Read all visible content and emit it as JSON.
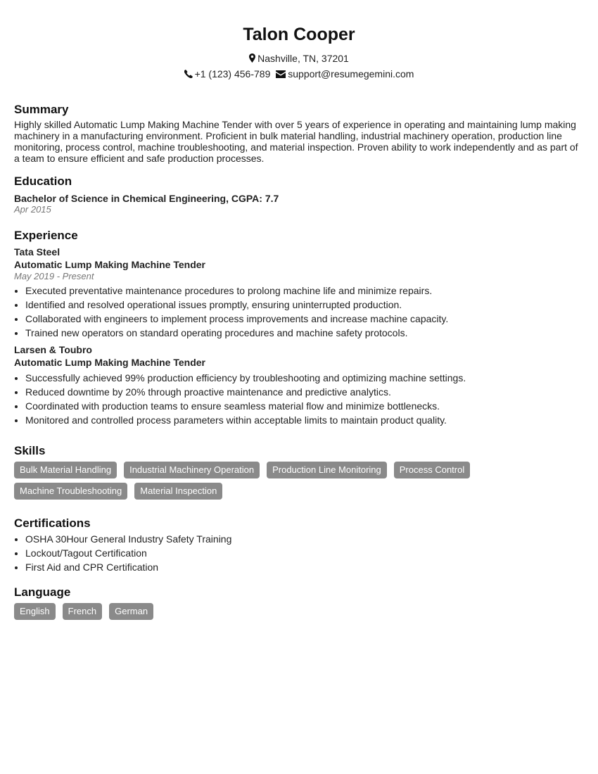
{
  "header": {
    "name": "Talon Cooper",
    "location": "Nashville, TN, 37201",
    "phone": "+1 (123) 456-789",
    "email": "support@resumegemini.com",
    "icons": {
      "location": "map-marker-icon",
      "phone": "phone-icon",
      "email": "envelope-icon"
    }
  },
  "summary": {
    "title": "Summary",
    "text": "Highly skilled Automatic Lump Making Machine Tender with over 5 years of experience in operating and maintaining lump making machinery in a manufacturing environment. Proficient in bulk material handling, industrial machinery operation, production line monitoring, process control, machine troubleshooting, and material inspection. Proven ability to work independently and as part of a team to ensure efficient and safe production processes."
  },
  "education": {
    "title": "Education",
    "degree": "Bachelor of Science in Chemical Engineering, CGPA: 7.7",
    "date": "Apr 2015"
  },
  "experience": {
    "title": "Experience",
    "jobs": [
      {
        "company": "Tata Steel",
        "role": "Automatic Lump Making Machine Tender",
        "date": "May 2019 - Present",
        "bullets": [
          "Executed preventative maintenance procedures to prolong machine life and minimize repairs.",
          "Identified and resolved operational issues promptly, ensuring uninterrupted production.",
          "Collaborated with engineers to implement process improvements and increase machine capacity.",
          "Trained new operators on standard operating procedures and machine safety protocols."
        ]
      },
      {
        "company": "Larsen & Toubro",
        "role": "Automatic Lump Making Machine Tender",
        "bullets": [
          "Successfully achieved 99% production efficiency by troubleshooting and optimizing machine settings.",
          "Reduced downtime by 20% through proactive maintenance and predictive analytics.",
          "Coordinated with production teams to ensure seamless material flow and minimize bottlenecks.",
          "Monitored and controlled process parameters within acceptable limits to maintain product quality."
        ]
      }
    ]
  },
  "skills": {
    "title": "Skills",
    "items": [
      "Bulk Material Handling",
      "Industrial Machinery Operation",
      "Production Line Monitoring",
      "Process Control",
      "Machine Troubleshooting",
      "Material Inspection"
    ]
  },
  "certifications": {
    "title": "Certifications",
    "items": [
      "OSHA 30Hour General Industry Safety Training",
      "Lockout/Tagout Certification",
      "First Aid and CPR Certification"
    ]
  },
  "language": {
    "title": "Language",
    "items": [
      "English",
      "French",
      "German"
    ]
  },
  "colors": {
    "tag_background": "#8a8a8a",
    "tag_text": "#ffffff",
    "date_text": "#777777"
  }
}
